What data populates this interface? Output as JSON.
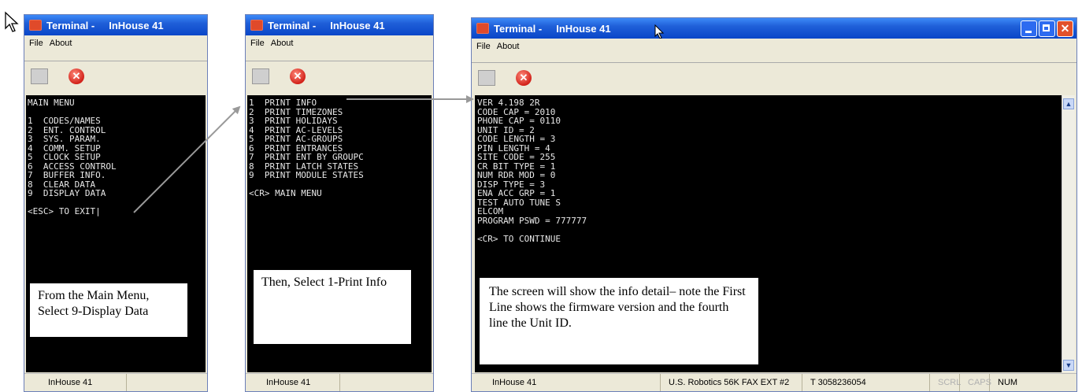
{
  "window1": {
    "title": "Terminal -     InHouse 41",
    "menu": [
      "File",
      "About"
    ],
    "screen_lines": [
      "MAIN MENU",
      "",
      "1  CODES/NAMES",
      "2  ENT. CONTROL",
      "3  SYS. PARAM.",
      "4  COMM. SETUP",
      "5  CLOCK SETUP",
      "6  ACCESS CONTROL",
      "7  BUFFER INFO.",
      "8  CLEAR DATA",
      "9  DISPLAY DATA",
      "",
      "<ESC> TO EXIT|"
    ],
    "status": "InHouse 41",
    "callout": "From the Main Menu, Select 9-Display Data"
  },
  "window2": {
    "title": "Terminal -     InHouse 41",
    "menu": [
      "File",
      "About"
    ],
    "screen_lines": [
      "1  PRINT INFO",
      "2  PRINT TIMEZONES",
      "3  PRINT HOLIDAYS",
      "4  PRINT AC-LEVELS",
      "5  PRINT AC-GROUPS",
      "6  PRINT ENTRANCES",
      "7  PRINT ENT BY GROUPC",
      "8  PRINT LATCH STATES",
      "9  PRINT MODULE STATES",
      "",
      "<CR> MAIN MENU"
    ],
    "status": "InHouse 41",
    "callout": "Then, Select 1-Print Info"
  },
  "window3": {
    "title": "Terminal -     InHouse 41",
    "menu": [
      "File",
      "About"
    ],
    "screen_lines": [
      "VER 4.198 2R",
      "CODE CAP = 2010",
      "PHONE CAP = 0110",
      "UNIT ID = 2",
      "CODE LENGTH = 3",
      "PIN LENGTH = 4",
      "SITE CODE = 255",
      "CR BIT TYPE = 1",
      "NUM RDR MOD = 0",
      "DISP TYPE = 3",
      "ENA ACC GRP = 1",
      "TEST AUTO TUNE S",
      "ELCOM",
      "PROGRAM PSWD = 777777",
      "",
      "<CR> TO CONTINUE"
    ],
    "status_panels": [
      "InHouse 41",
      "U.S. Robotics 56K FAX EXT #2",
      "T 3058236054",
      "SCRL",
      "CAPS",
      "NUM"
    ],
    "callout": "The screen will show the info detail– note the First Line shows the firmware version and the fourth line the Unit ID."
  },
  "icons": [
    "cursor-arrow-icon",
    "terminal-icon",
    "edit-icon",
    "close-icon",
    "minimize-icon",
    "maximize-icon",
    "arrow-icon"
  ],
  "colors": {
    "titlebar": "#0a46c8",
    "close_button": "#d2221a",
    "screen_bg": "#000000",
    "chrome": "#ece9d8"
  }
}
